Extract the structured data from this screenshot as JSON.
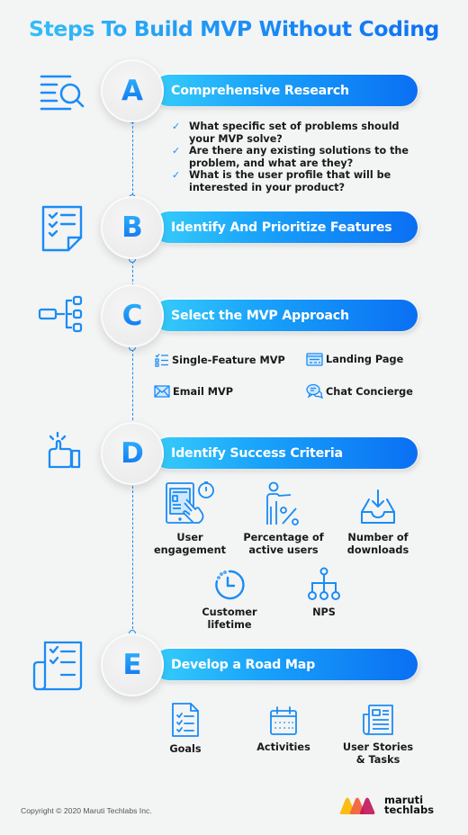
{
  "title": "Steps To Build MVP Without Coding",
  "colors": {
    "accent": "#1a8cf6",
    "accent_light": "#37cdfa",
    "accent_dark": "#0a6ff3",
    "background": "#f3f4f4"
  },
  "steps": [
    {
      "letter": "A",
      "label": "Comprehensive Research",
      "icon": "document-search-icon",
      "bullets": [
        "What specific set of problems should your MVP solve?",
        "Are there any existing solutions to the problem, and what are they?",
        "What is the user profile that will be interested in your product?"
      ]
    },
    {
      "letter": "B",
      "label": "Identify And Prioritize Features",
      "icon": "checklist-icon"
    },
    {
      "letter": "C",
      "label": "Select the MVP Approach",
      "icon": "hierarchy-icon",
      "approaches": [
        {
          "label": "Single-Feature MVP",
          "icon": "list-icon"
        },
        {
          "label": "Landing Page",
          "icon": "browser-icon"
        },
        {
          "label": "Email MVP",
          "icon": "envelope-icon"
        },
        {
          "label": "Chat Concierge",
          "icon": "chat-icon"
        }
      ]
    },
    {
      "letter": "D",
      "label": "Identify Success Criteria",
      "icon": "thumbs-up-icon",
      "metrics": [
        {
          "label_line1": "User",
          "label_line2": "engagement",
          "icon": "tablet-tap-icon"
        },
        {
          "label_line1": "Percentage of",
          "label_line2": "active users",
          "icon": "person-percent-icon"
        },
        {
          "label_line1": "Number of",
          "label_line2": "downloads",
          "icon": "download-tray-icon"
        },
        {
          "label_line1": "Customer",
          "label_line2": "lifetime",
          "icon": "clock-icon"
        },
        {
          "label_line1": "NPS",
          "label_line2": "",
          "icon": "network-icon"
        }
      ]
    },
    {
      "letter": "E",
      "label": "Develop a Road Map",
      "icon": "scroll-checklist-icon",
      "items": [
        {
          "label_line1": "Goals",
          "label_line2": "",
          "icon": "goals-document-icon"
        },
        {
          "label_line1": "Activities",
          "label_line2": "",
          "icon": "calendar-icon"
        },
        {
          "label_line1": "User Stories",
          "label_line2": "& Tasks",
          "icon": "newspaper-icon"
        }
      ]
    }
  ],
  "bullet_check": "✓",
  "footer": {
    "copyright": "Copyright © 2020 Maruti Techlabs Inc.",
    "logo_line1": "maruti",
    "logo_line2": "techlabs"
  }
}
